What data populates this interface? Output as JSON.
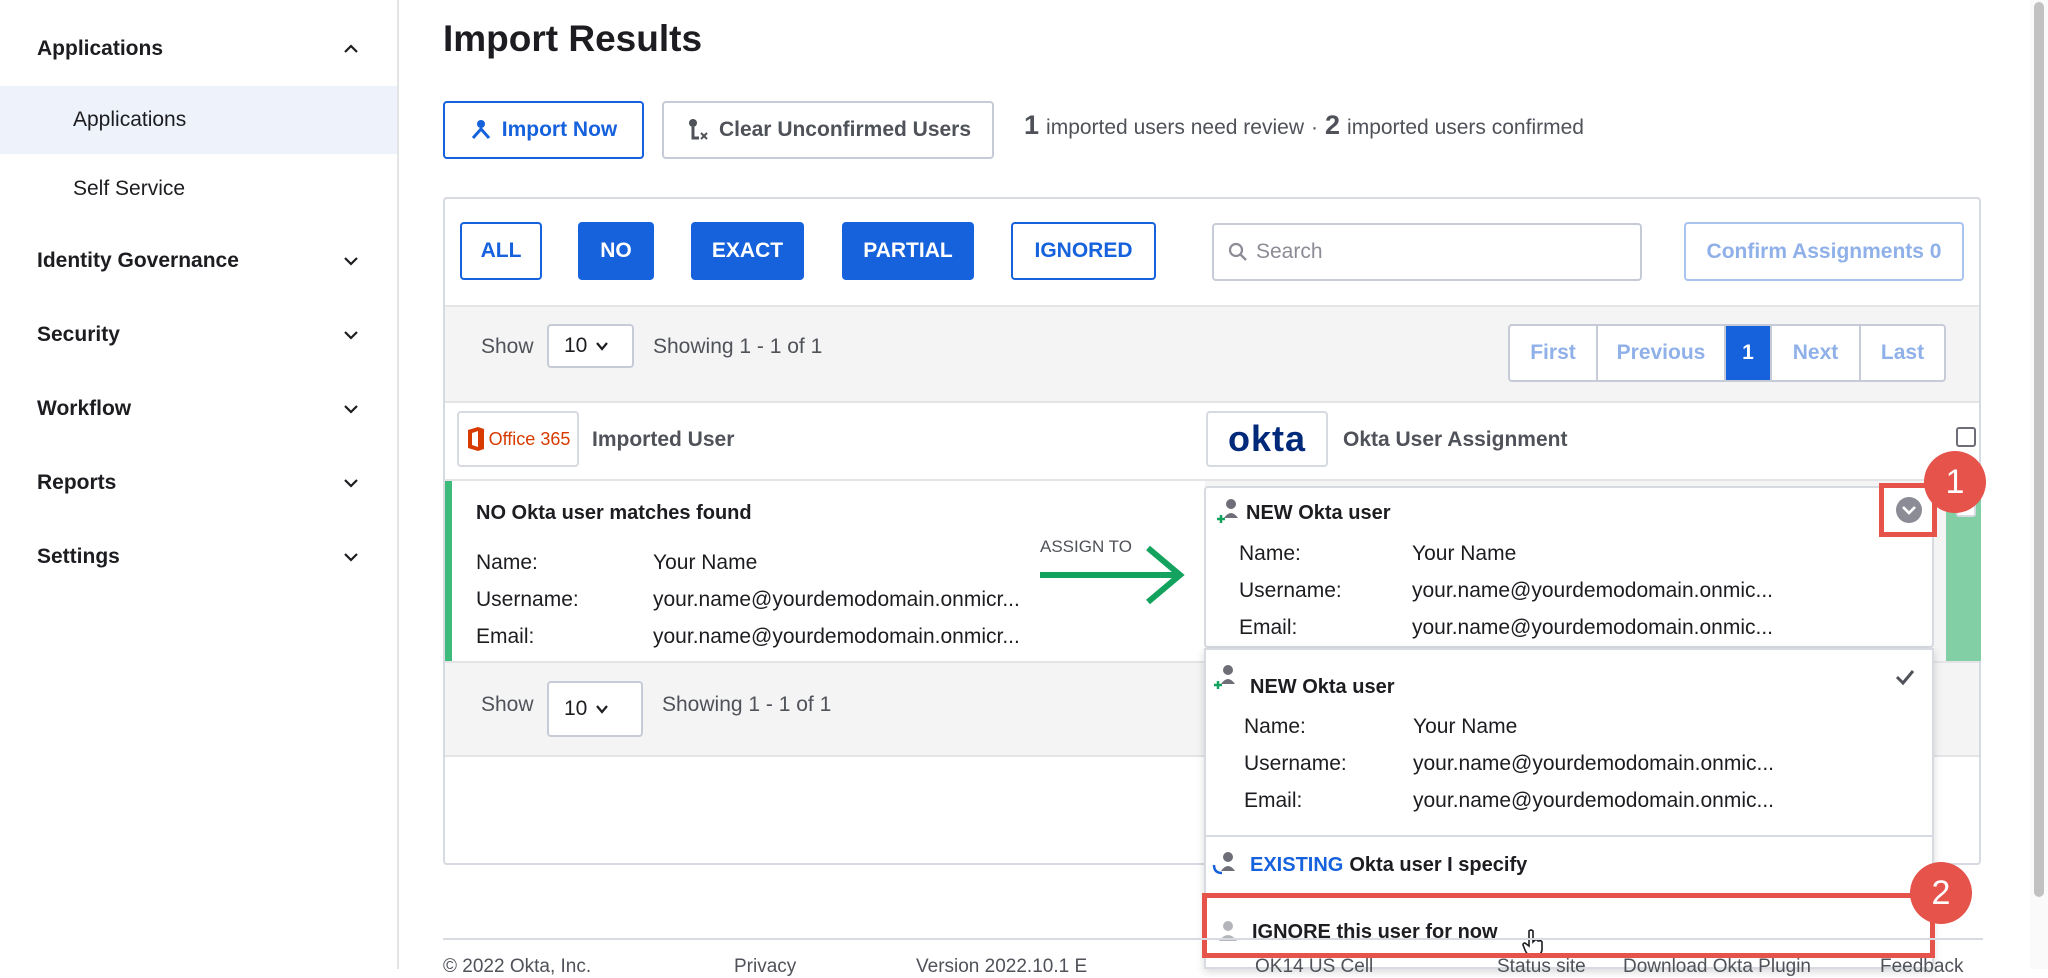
{
  "sidebar": {
    "sections": [
      {
        "label": "Applications",
        "expanded": true
      },
      {
        "label": "Identity Governance",
        "expanded": false
      },
      {
        "label": "Security",
        "expanded": false
      },
      {
        "label": "Workflow",
        "expanded": false
      },
      {
        "label": "Reports",
        "expanded": false
      },
      {
        "label": "Settings",
        "expanded": false
      }
    ],
    "sub_items": [
      {
        "label": "Applications",
        "active": true
      },
      {
        "label": "Self Service",
        "active": false
      }
    ]
  },
  "page": {
    "title": "Import Results",
    "import_now": "Import Now",
    "clear_unconfirmed": "Clear Unconfirmed Users",
    "status": {
      "review_count": "1",
      "review_text": "imported users need review",
      "separator": "·",
      "confirmed_count": "2",
      "confirmed_text": "imported users confirmed"
    }
  },
  "filters": {
    "all": "ALL",
    "no": "NO",
    "exact": "EXACT",
    "partial": "PARTIAL",
    "ignored": "IGNORED"
  },
  "search": {
    "placeholder": "Search"
  },
  "confirm_assignments": "Confirm Assignments 0",
  "paging": {
    "show_label": "Show",
    "page_size": "10",
    "showing": "Showing 1 - 1 of 1",
    "first": "First",
    "previous": "Previous",
    "current": "1",
    "next": "Next",
    "last": "Last"
  },
  "table": {
    "office_logo": "Office 365",
    "imported_user_header": "Imported User",
    "okta_logo": "okta",
    "assignment_header": "Okta User Assignment"
  },
  "row": {
    "match_status": "NO Okta user matches found",
    "assign_to": "ASSIGN TO",
    "name_label": "Name:",
    "name_value": "Your Name",
    "username_label": "Username:",
    "username_value": "your.name@yourdemodomain.onmicr...",
    "email_label": "Email:",
    "email_value": "your.name@yourdemodomain.onmicr...",
    "assignment": {
      "title": "NEW Okta user",
      "name_label": "Name:",
      "name_value": "Your Name",
      "username_label": "Username:",
      "username_value": "your.name@yourdemodomain.onmic...",
      "email_label": "Email:",
      "email_value": "your.name@yourdemodomain.onmic..."
    }
  },
  "dropdown": {
    "new_option": {
      "title": "NEW Okta user",
      "name_label": "Name:",
      "name_value": "Your Name",
      "username_label": "Username:",
      "username_value": "your.name@yourdemodomain.onmic...",
      "email_label": "Email:",
      "email_value": "your.name@yourdemodomain.onmic..."
    },
    "existing_keyword": "EXISTING",
    "existing_rest": "Okta user I specify",
    "ignore_option": "IGNORE this user for now"
  },
  "callouts": {
    "one": "1",
    "two": "2"
  },
  "footer": {
    "copyright": "© 2022 Okta, Inc.",
    "privacy": "Privacy",
    "version": "Version 2022.10.1 E",
    "cell": "OK14 US Cell",
    "status_site": "Status site",
    "plugin": "Download Okta Plugin",
    "feedback": "Feedback"
  },
  "colors": {
    "primary": "#1662dd",
    "success": "#3dbb7c",
    "callout": "#e5534b",
    "office_red": "#d83b01",
    "okta_navy": "#00297a"
  }
}
